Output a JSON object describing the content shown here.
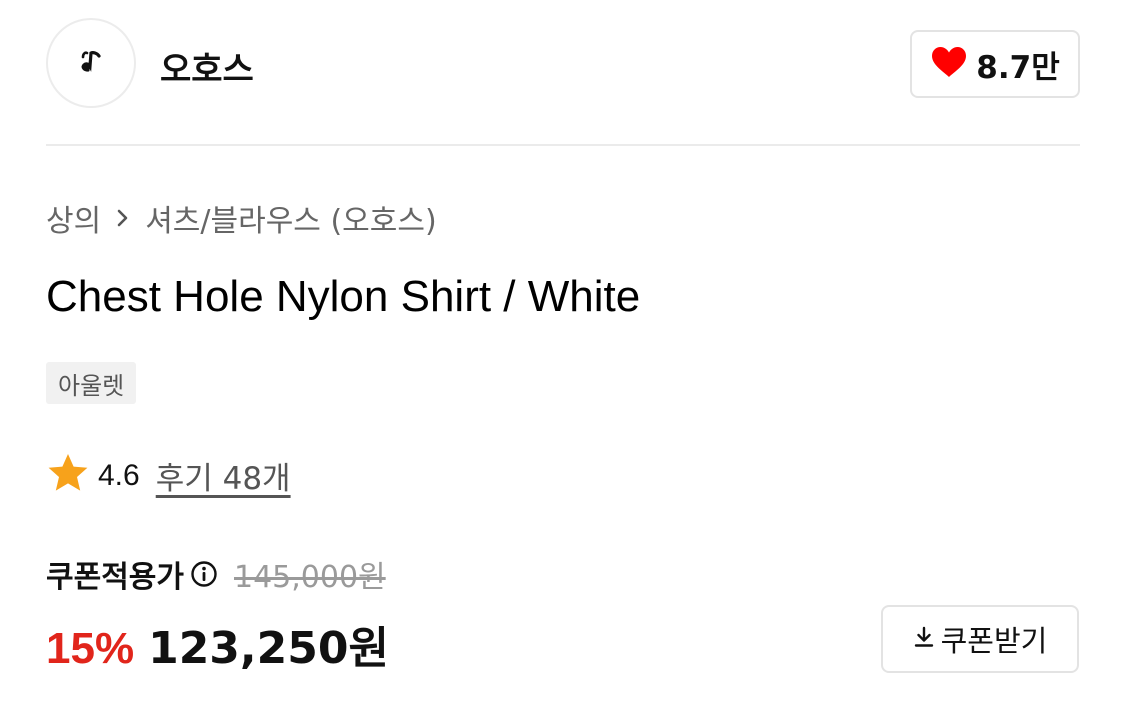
{
  "brand": {
    "name": "오호스",
    "logo_icon": "music-note-logo-icon",
    "likes": "8.7만",
    "like_icon": "heart-icon",
    "like_color": "#ff0000"
  },
  "breadcrumb": {
    "category": "상의",
    "separator_icon": "chevron-right-icon",
    "subcategory": "셔츠/블라우스 (오호스)"
  },
  "product": {
    "title": "Chest Hole Nylon Shirt / White",
    "tag": "아울렛"
  },
  "rating": {
    "star_icon": "star-icon",
    "star_color": "#f7a21b",
    "score": "4.6",
    "review_link": "후기 48개"
  },
  "price": {
    "label": "쿠폰적용가",
    "info_icon": "info-icon",
    "original": "145,000원",
    "discount_rate": "15%",
    "discount_color": "#e1251b",
    "final": "123,250원"
  },
  "coupon": {
    "button_icon": "download-icon",
    "button_label": "쿠폰받기"
  }
}
